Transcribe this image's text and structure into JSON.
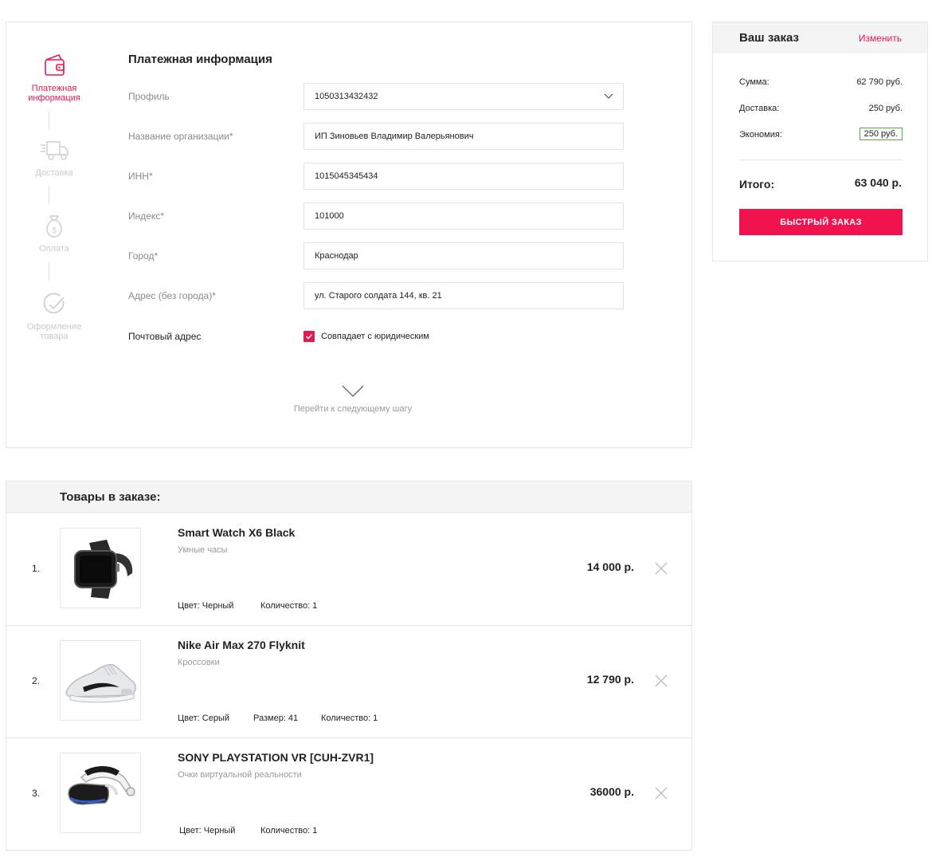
{
  "steps": [
    {
      "label_line1": "Платежная",
      "label_line2": "информация",
      "icon": "wallet-icon",
      "active": true
    },
    {
      "label_line1": "Доставка",
      "label_line2": "",
      "icon": "truck-icon",
      "active": false
    },
    {
      "label_line1": "Оплата",
      "label_line2": "",
      "icon": "money-bag-icon",
      "active": false
    },
    {
      "label_line1": "Оформление",
      "label_line2": "товара",
      "icon": "check-circle-icon",
      "active": false
    }
  ],
  "form": {
    "title": "Платежная информация",
    "profile_label": "Профиль",
    "profile_value": "1050313432432",
    "org_label": "Название организации*",
    "org_value": "ИП Зиновьев Владимир Валерьянович",
    "inn_label": "ИНН*",
    "inn_value": "1015045345434",
    "index_label": "Индекс*",
    "index_value": "101000",
    "city_label": "Город*",
    "city_value": "Краснодар",
    "address_label": "Адрес (без города)*",
    "address_value": "ул. Старого солдата 144, кв. 21",
    "postal_label": "Почтовый адрес",
    "postal_checkbox_label": "Совпадает с юридическим",
    "postal_checked": true,
    "next_step": "Перейти к следующему шагу"
  },
  "order": {
    "title": "Ваш заказ",
    "edit": "Изменить",
    "sum_label": "Сумма:",
    "sum_value": "62 790 руб.",
    "delivery_label": "Доставка:",
    "delivery_value": "250 руб.",
    "saving_label": "Экономия:",
    "saving_value": "250 руб.",
    "total_label": "Итого:",
    "total_value": "63 040 р.",
    "quick_button": "БЫСТРЫЙ ЗАКАЗ"
  },
  "items_section": {
    "title": "Товары в заказе:",
    "items": [
      {
        "num": "1.",
        "name": "Smart Watch X6 Black",
        "category": "Умные часы",
        "color": "Цвет: Черный",
        "size": "",
        "qty": "Количество: 1",
        "price": "14 000 р."
      },
      {
        "num": "2.",
        "name": "Nike Air Max 270 Flyknit",
        "category": "Кроссовки",
        "color": "Цвет: Серый",
        "size": "Размер: 41",
        "qty": "Количество: 1",
        "price": "12 790 р."
      },
      {
        "num": "3.",
        "name": "SONY PLAYSTATION VR [CUH-ZVR1]",
        "category": "Очки виртуальной реальности",
        "color": "Цвет: Черный",
        "size": "",
        "qty": "Количество: 1",
        "price": "36000 р."
      }
    ]
  },
  "colors": {
    "accent": "#e8174c",
    "button": "#f0134d",
    "saving_border": "#5aa84a",
    "muted": "#c9c9c9"
  }
}
